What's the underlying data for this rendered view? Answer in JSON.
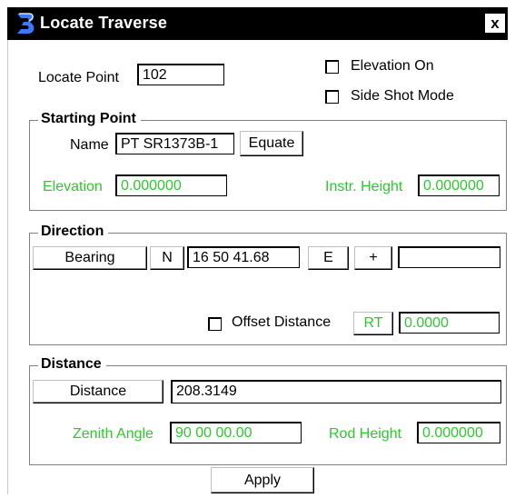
{
  "window": {
    "title": "Locate Traverse",
    "icon": "bentley-b-icon",
    "close_label": "x"
  },
  "locate_point": {
    "label": "Locate Point",
    "value": "102"
  },
  "options": {
    "elevation_on": {
      "label": "Elevation On",
      "checked": false
    },
    "side_shot_mode": {
      "label": "Side Shot Mode",
      "checked": false
    }
  },
  "starting_point": {
    "title": "Starting Point",
    "name_label": "Name",
    "name_value": "PT SR1373B-1",
    "equate_label": "Equate",
    "elevation_label": "Elevation",
    "elevation_value": "0.000000",
    "instr_height_label": "Instr. Height",
    "instr_height_value": "0.000000"
  },
  "direction": {
    "title": "Direction",
    "mode_label": "Bearing",
    "ns_label": "N",
    "angle_value": "16 50 41.68",
    "ew_label": "E",
    "plus_label": "+",
    "extra_value": "",
    "offset_distance_label": "Offset Distance",
    "offset_checked": false,
    "side_label": "RT",
    "offset_value": "0.0000"
  },
  "distance": {
    "title": "Distance",
    "mode_label": "Distance",
    "distance_value": "208.3149",
    "zenith_label": "Zenith Angle",
    "zenith_value": "90 00 00.00",
    "rod_height_label": "Rod Height",
    "rod_height_value": "0.000000"
  },
  "apply_label": "Apply",
  "colors": {
    "accent_green": "#2fc62f",
    "titlebar": "#000000"
  }
}
